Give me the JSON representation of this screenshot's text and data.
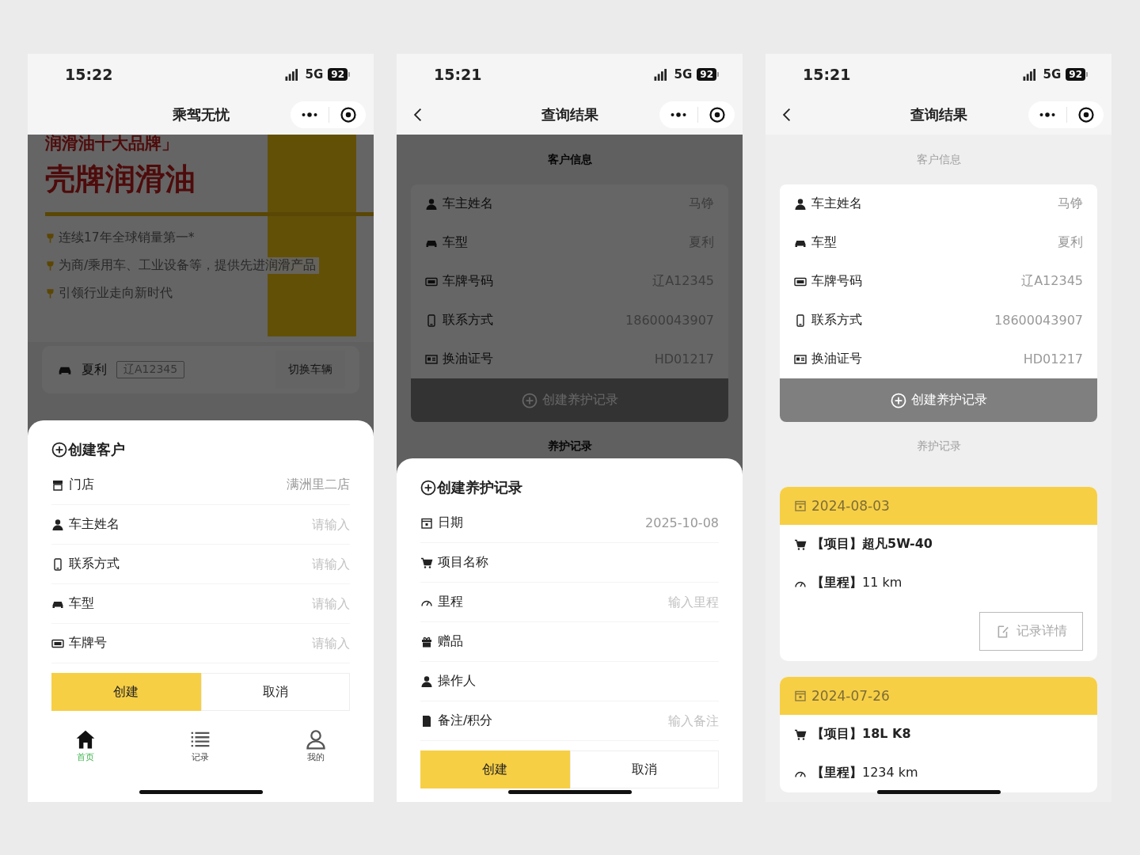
{
  "screens": [
    {
      "kind": "home",
      "status": {
        "time": "15:22",
        "network": "5G",
        "battery": "92"
      },
      "nav": {
        "title": "乘驾无忧",
        "back": false
      },
      "banner": {
        "kicker": "润滑油十大品牌」",
        "headline": "壳牌润滑油",
        "bullets": [
          "连续17年全球销量第一*",
          "为商/乘用车、工业设备等，提供先进润滑产品",
          "引领行业走向新时代"
        ]
      },
      "vehicle": {
        "model": "夏利",
        "plate": "辽A12345",
        "switch": "切换车辆"
      },
      "sheet": {
        "title": "创建客户",
        "fields": [
          {
            "kind": "store",
            "label": "门店",
            "value": "满洲里二店"
          },
          {
            "kind": "person",
            "label": "车主姓名",
            "placeholder": "请输入"
          },
          {
            "kind": "phone",
            "label": "联系方式",
            "placeholder": "请输入"
          },
          {
            "kind": "car",
            "label": "车型",
            "placeholder": "请输入"
          },
          {
            "kind": "plate",
            "label": "车牌号",
            "placeholder": "请输入"
          }
        ],
        "buttons": [
          {
            "kind": "primary",
            "label": "创建"
          },
          {
            "kind": "secondary",
            "label": "取消"
          }
        ]
      },
      "tabbar": [
        {
          "kind": "home",
          "label": "首页",
          "selected": true
        },
        {
          "kind": "list",
          "label": "记录",
          "selected": false
        },
        {
          "kind": "user",
          "label": "我的",
          "selected": false
        }
      ]
    },
    {
      "kind": "result",
      "status": {
        "time": "15:21",
        "network": "5G",
        "battery": "92"
      },
      "nav": {
        "title": "查询结果",
        "back": true
      },
      "customer_section": "客户信息",
      "customer": [
        {
          "kind": "person",
          "label": "车主姓名",
          "value": "马铮"
        },
        {
          "kind": "car",
          "label": "车型",
          "value": "夏利"
        },
        {
          "kind": "plate",
          "label": "车牌号码",
          "value": "辽A12345"
        },
        {
          "kind": "phone",
          "label": "联系方式",
          "value": "18600043907"
        },
        {
          "kind": "card",
          "label": "换油证号",
          "value": "HD01217"
        }
      ],
      "create_button": "创建养护记录",
      "records_section": "养护记录",
      "sheet": {
        "title": "创建养护记录",
        "fields": [
          {
            "kind": "date",
            "label": "日期",
            "value": "2025-10-08"
          },
          {
            "kind": "item",
            "label": "项目名称"
          },
          {
            "kind": "mileage",
            "label": "里程",
            "placeholder": "输入里程"
          },
          {
            "kind": "gift",
            "label": "赠品"
          },
          {
            "kind": "person",
            "label": "操作人"
          },
          {
            "kind": "note",
            "label": "备注/积分",
            "placeholder": "输入备注"
          }
        ],
        "buttons": [
          {
            "kind": "primary",
            "label": "创建"
          },
          {
            "kind": "secondary",
            "label": "取消"
          }
        ]
      }
    },
    {
      "kind": "result",
      "status": {
        "time": "15:21",
        "network": "5G",
        "battery": "92"
      },
      "nav": {
        "title": "查询结果",
        "back": true
      },
      "customer_section": "客户信息",
      "customer": [
        {
          "kind": "person",
          "label": "车主姓名",
          "value": "马铮"
        },
        {
          "kind": "car",
          "label": "车型",
          "value": "夏利"
        },
        {
          "kind": "plate",
          "label": "车牌号码",
          "value": "辽A12345"
        },
        {
          "kind": "phone",
          "label": "联系方式",
          "value": "18600043907"
        },
        {
          "kind": "card",
          "label": "换油证号",
          "value": "HD01217"
        }
      ],
      "create_button": "创建养护记录",
      "records_section": "养护记录",
      "records": [
        {
          "date": "2024-08-03",
          "item": "【项目】超凡5W-40",
          "mileage": "**【里程】**11 km",
          "detail": "记录详情"
        },
        {
          "date": "2024-07-26",
          "item": "【项目】18L K8",
          "mileage": "**【里程】**1234 km"
        }
      ]
    }
  ]
}
